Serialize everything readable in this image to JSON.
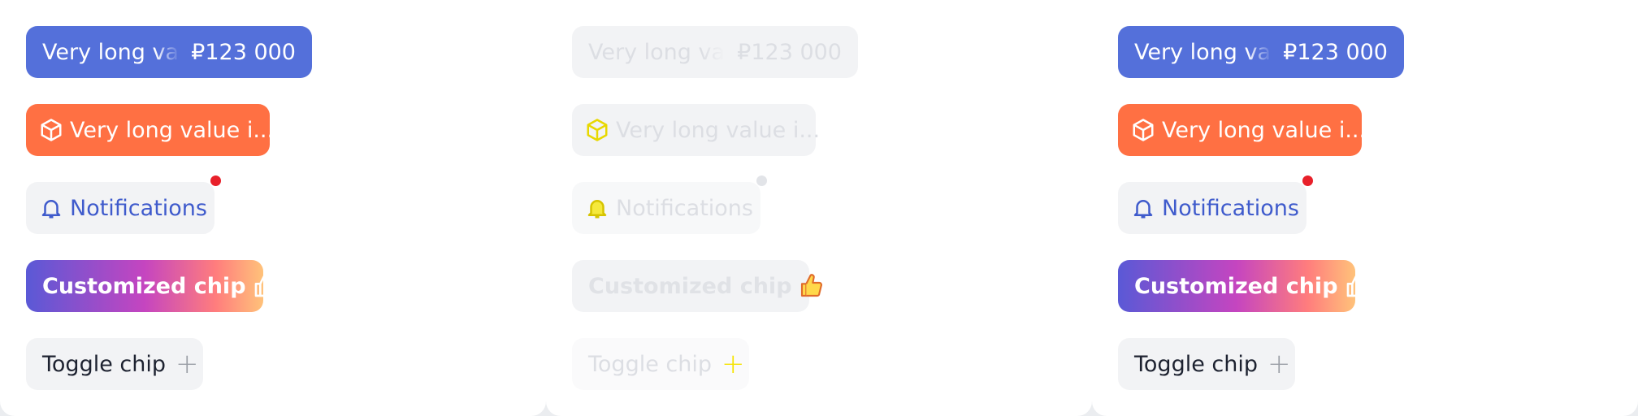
{
  "columns": [
    {
      "chip_value": {
        "label": "Very long value",
        "amount": "₽123 000"
      },
      "chip_truncated": {
        "label": "Very long value i...",
        "icon": "cube-icon"
      },
      "chip_notifications": {
        "label": "Notifications",
        "icon": "bell-icon",
        "badge_color": "#e8202a"
      },
      "chip_custom": {
        "label": "Customized chip",
        "icon": "thumbs-up-icon"
      },
      "chip_toggle": {
        "label": "Toggle chip",
        "icon": "plus-icon",
        "glyph": "+"
      }
    },
    {
      "chip_value": {
        "label": "Very long value",
        "amount": "₽123 000"
      },
      "chip_truncated": {
        "label": "Very long value i...",
        "icon": "cube-icon"
      },
      "chip_notifications": {
        "label": "Notifications",
        "icon": "bell-icon",
        "badge_color": "#e2e4e8"
      },
      "chip_custom": {
        "label": "Customized chip",
        "icon": "thumbs-up-icon"
      },
      "chip_toggle": {
        "label": "Toggle chip",
        "icon": "plus-icon",
        "glyph": "+"
      }
    },
    {
      "chip_value": {
        "label": "Very long value",
        "amount": "₽123 000"
      },
      "chip_truncated": {
        "label": "Very long value i...",
        "icon": "cube-icon"
      },
      "chip_notifications": {
        "label": "Notifications",
        "icon": "bell-icon",
        "badge_color": "#e8202a"
      },
      "chip_custom": {
        "label": "Customized chip",
        "icon": "thumbs-up-icon"
      },
      "chip_toggle": {
        "label": "Toggle chip",
        "icon": "plus-icon",
        "glyph": "+"
      }
    }
  ],
  "colors": {
    "primary": "#5470da",
    "orange": "#ff7043",
    "link_blue": "#3f5bcc",
    "neutral_bg": "#f2f3f5",
    "disabled_text": "#dcdee3"
  }
}
